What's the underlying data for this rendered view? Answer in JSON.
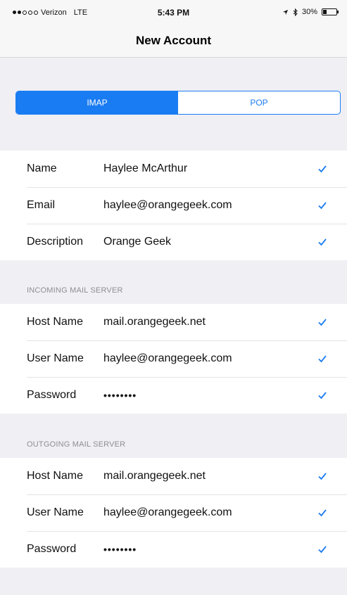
{
  "status_bar": {
    "carrier": "Verizon",
    "network": "LTE",
    "time": "5:43 PM",
    "battery_percent": "30%",
    "battery_level": 0.3
  },
  "nav": {
    "title": "New Account"
  },
  "account_type": {
    "options": [
      "IMAP",
      "POP"
    ],
    "selected": "IMAP"
  },
  "account": {
    "rows": [
      {
        "label": "Name",
        "value": "Haylee McArthur"
      },
      {
        "label": "Email",
        "value": "haylee@orangegeek.com"
      },
      {
        "label": "Description",
        "value": "Orange Geek"
      }
    ]
  },
  "incoming": {
    "header": "INCOMING MAIL SERVER",
    "rows": [
      {
        "label": "Host Name",
        "value": "mail.orangegeek.net"
      },
      {
        "label": "User Name",
        "value": "haylee@orangegeek.com"
      },
      {
        "label": "Password",
        "value": "••••••••"
      }
    ]
  },
  "outgoing": {
    "header": "OUTGOING MAIL SERVER",
    "rows": [
      {
        "label": "Host Name",
        "value": "mail.orangegeek.net"
      },
      {
        "label": "User Name",
        "value": "haylee@orangegeek.com"
      },
      {
        "label": "Password",
        "value": "••••••••"
      }
    ]
  },
  "colors": {
    "accent": "#1a7cf2",
    "background": "#efeff4",
    "section_header": "#8e8e93"
  },
  "icons": {
    "row_check": "checkmark-icon",
    "location": "location-arrow-icon",
    "bluetooth": "bluetooth-icon",
    "battery": "battery-icon"
  }
}
